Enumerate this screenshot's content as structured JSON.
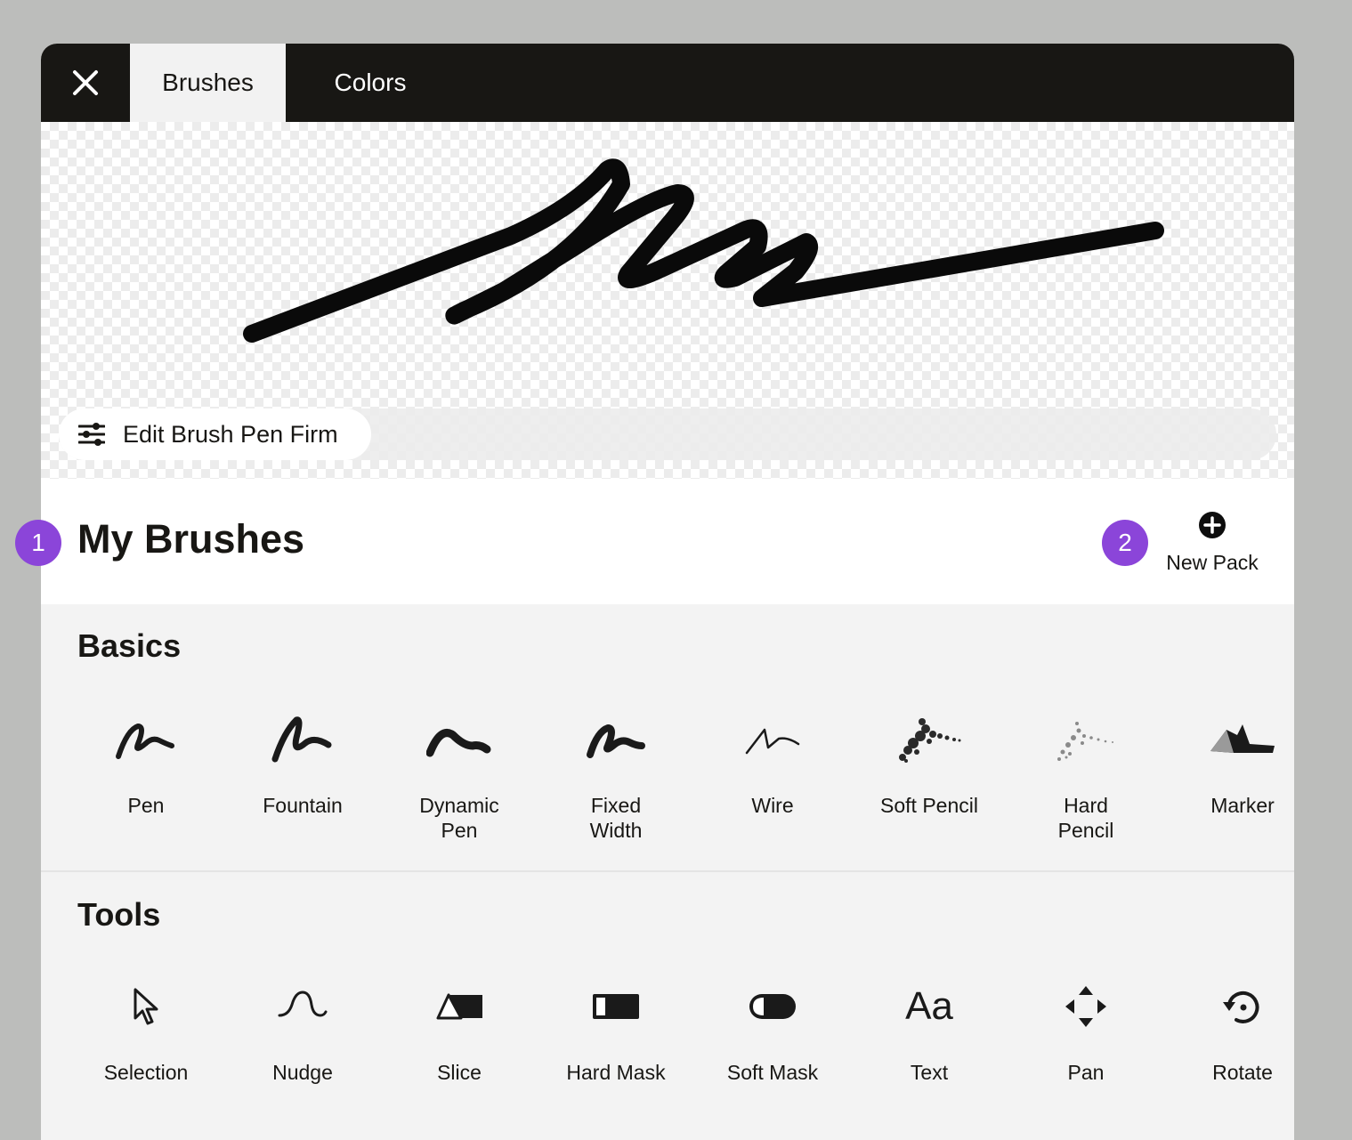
{
  "header": {
    "close_icon": "close-icon",
    "tabs": [
      {
        "label": "Brushes",
        "active": true
      },
      {
        "label": "Colors",
        "active": false
      }
    ]
  },
  "preview": {
    "edit_label": "Edit Brush Pen Firm",
    "edit_icon": "sliders-icon"
  },
  "my_brushes": {
    "title": "My Brushes",
    "new_pack_label": "New Pack",
    "new_pack_icon": "plus-circle-icon"
  },
  "badges": [
    "1",
    "2"
  ],
  "sections": {
    "basics": {
      "title": "Basics",
      "items": [
        {
          "label": "Pen",
          "icon": "pen-brush-icon"
        },
        {
          "label": "Fountain",
          "icon": "fountain-brush-icon"
        },
        {
          "label": "Dynamic Pen",
          "icon": "dynamic-pen-brush-icon"
        },
        {
          "label": "Fixed Width",
          "icon": "fixed-width-brush-icon"
        },
        {
          "label": "Wire",
          "icon": "wire-brush-icon"
        },
        {
          "label": "Soft Pencil",
          "icon": "soft-pencil-brush-icon"
        },
        {
          "label": "Hard Pencil",
          "icon": "hard-pencil-brush-icon"
        },
        {
          "label": "Marker",
          "icon": "marker-brush-icon"
        }
      ]
    },
    "tools": {
      "title": "Tools",
      "items": [
        {
          "label": "Selection",
          "icon": "cursor-icon"
        },
        {
          "label": "Nudge",
          "icon": "nudge-icon"
        },
        {
          "label": "Slice",
          "icon": "slice-icon"
        },
        {
          "label": "Hard Mask",
          "icon": "hard-mask-icon"
        },
        {
          "label": "Soft Mask",
          "icon": "soft-mask-icon"
        },
        {
          "label": "Text",
          "icon": "text-icon",
          "glyph": "Aa"
        },
        {
          "label": "Pan",
          "icon": "pan-icon"
        },
        {
          "label": "Rotate",
          "icon": "rotate-icon"
        }
      ]
    }
  },
  "colors": {
    "topbar": "#181714",
    "badge": "#8b45d9",
    "text": "#181714"
  }
}
